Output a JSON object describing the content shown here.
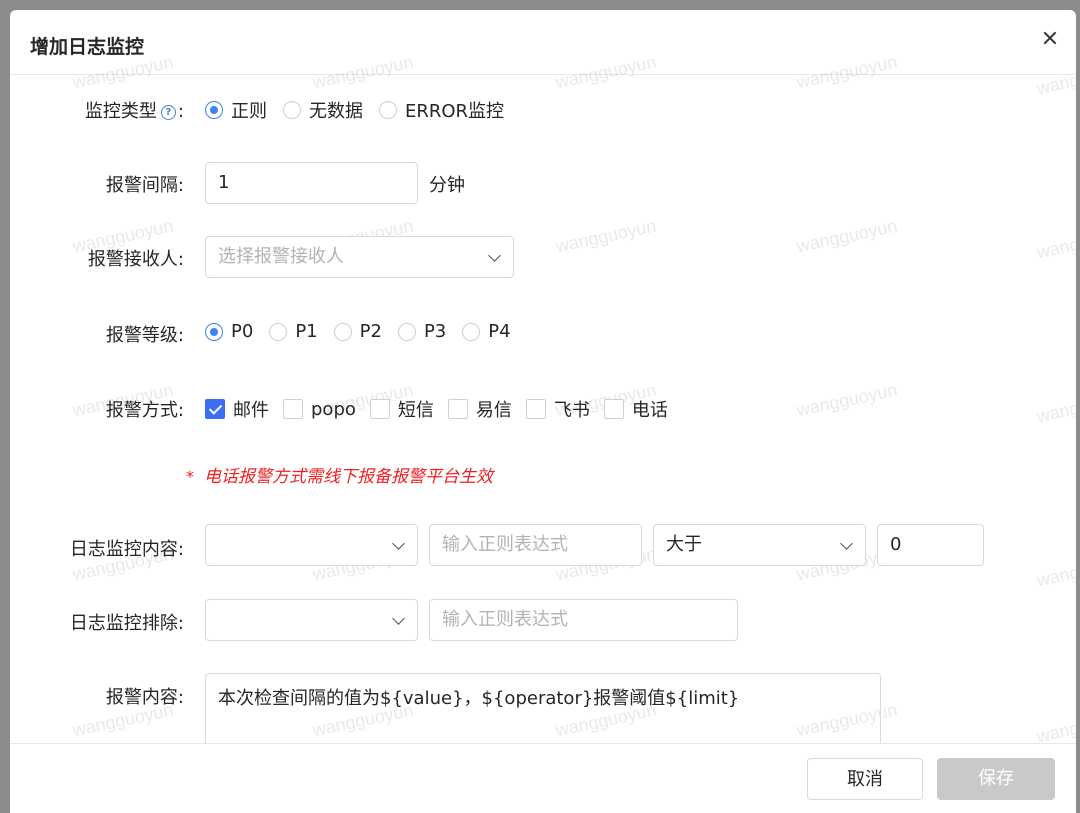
{
  "dialog": {
    "title": "增加日志监控"
  },
  "watermark": "wangguoyun",
  "monitor_type": {
    "label": "监控类型",
    "colon": ":",
    "help": "?",
    "options": [
      "正则",
      "无数据",
      "ERROR监控"
    ],
    "selected": "正则"
  },
  "interval": {
    "label": "报警间隔:",
    "value": "1",
    "unit": "分钟"
  },
  "receiver": {
    "label": "报警接收人:",
    "placeholder": "选择报警接收人"
  },
  "level": {
    "label": "报警等级:",
    "options": [
      "P0",
      "P1",
      "P2",
      "P3",
      "P4"
    ],
    "selected": "P0"
  },
  "method": {
    "label": "报警方式:",
    "options": [
      "邮件",
      "popo",
      "短信",
      "易信",
      "飞书",
      "电话"
    ],
    "checked": [
      "邮件"
    ]
  },
  "note": {
    "star": "*",
    "text": "电话报警方式需线下报备报警平台生效"
  },
  "log_content": {
    "label": "日志监控内容:",
    "select_value": "",
    "regex_placeholder": "输入正则表达式",
    "operator": "大于",
    "threshold": "0"
  },
  "log_exclude": {
    "label": "日志监控排除:",
    "select_value": "",
    "regex_placeholder": "输入正则表达式"
  },
  "alert_content": {
    "label": "报警内容:",
    "value": "本次检查间隔的值为${value}，${operator}报警阈值${limit}"
  },
  "footer": {
    "cancel": "取消",
    "save": "保存"
  },
  "colors": {
    "accent": "#3b82f6",
    "note": "#f02020",
    "save_disabled": "#c9c9c9"
  }
}
